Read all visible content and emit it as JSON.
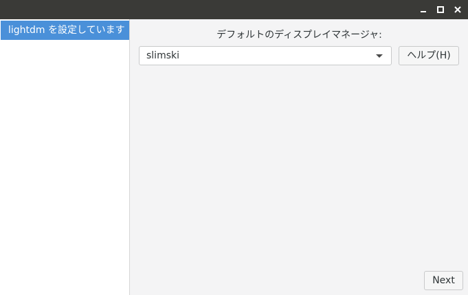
{
  "titlebar": {
    "minimize_icon": "minimize-icon",
    "maximize_icon": "maximize-icon",
    "close_icon": "close-icon"
  },
  "sidebar": {
    "items": [
      {
        "label": "lightdm を設定しています",
        "selected": true
      }
    ]
  },
  "main": {
    "prompt": "デフォルトのディスプレイマネージャ:",
    "selected_option": "slimski",
    "help_label": "ヘルプ(H)"
  },
  "footer": {
    "next_label": "Next"
  },
  "colors": {
    "accent": "#4a90d9",
    "titlebar": "#3a3a37",
    "background": "#f4f4f5"
  }
}
